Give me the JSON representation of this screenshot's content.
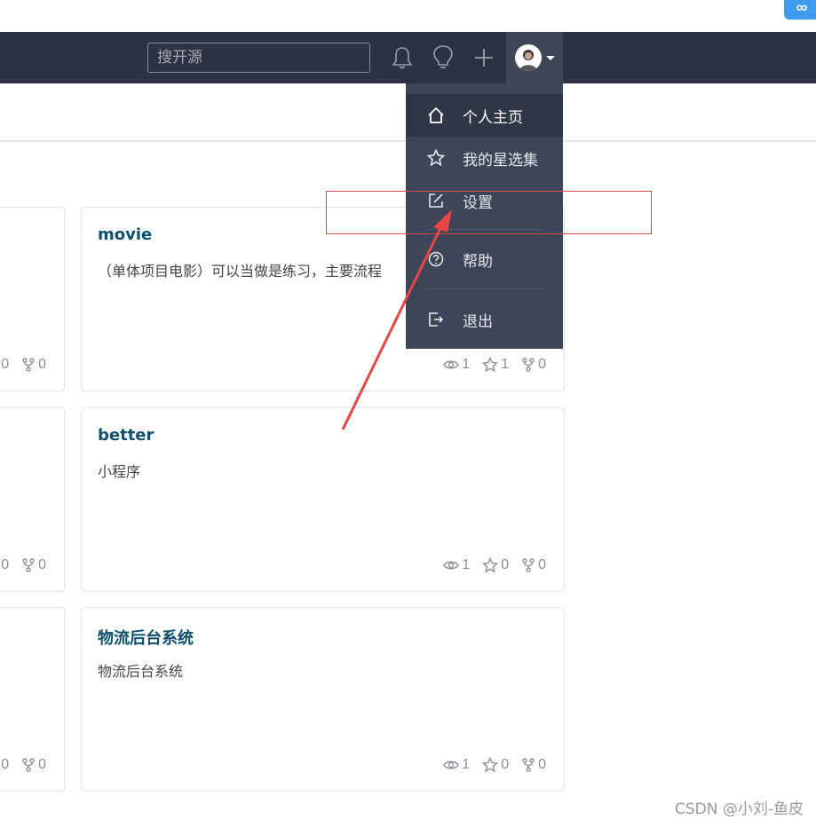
{
  "navbar": {
    "search_placeholder": "搜开源"
  },
  "dropdown": {
    "items": [
      {
        "label": "个人主页",
        "icon": "home-icon"
      },
      {
        "label": "我的星选集",
        "icon": "star-icon"
      },
      {
        "label": "设置",
        "icon": "edit-icon"
      },
      {
        "label": "帮助",
        "icon": "help-circle-icon"
      },
      {
        "label": "退出",
        "icon": "logout-icon"
      }
    ]
  },
  "cards_left": [
    {
      "forks": "0",
      "stars_tail": "0"
    },
    {
      "forks": "0",
      "stars_tail": "0"
    },
    {
      "forks": "0",
      "stars_tail": "0"
    }
  ],
  "cards": [
    {
      "title": "movie",
      "desc": "（单体项目电影）可以当做是练习，主要流程",
      "watch": "1",
      "star": "1",
      "fork": "0"
    },
    {
      "title": "better",
      "desc": "小程序",
      "watch": "1",
      "star": "0",
      "fork": "0"
    },
    {
      "title": "物流后台系统",
      "desc": "物流后台系统",
      "watch": "1",
      "star": "0",
      "fork": "0"
    }
  ],
  "watermark": "CSDN @小刘-鱼皮",
  "colors": {
    "navbar": "#2b3242",
    "dropdown": "#3d4658",
    "title": "#0e4f6e",
    "annotation": "#e84545"
  }
}
